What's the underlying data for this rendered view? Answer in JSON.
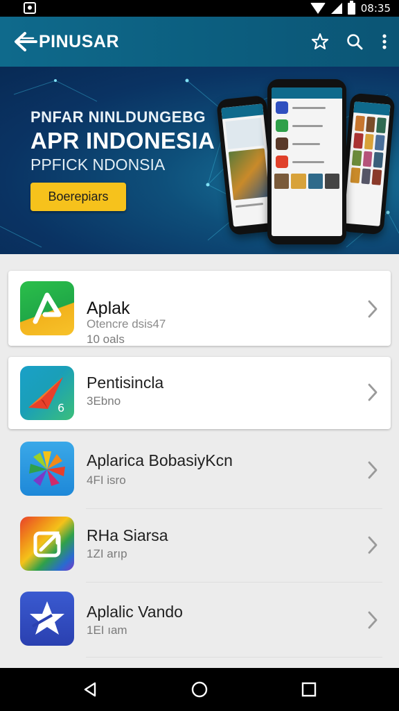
{
  "status_bar": {
    "time": "08:35"
  },
  "app_bar": {
    "title": "PINUSAR",
    "icons": [
      "back-arrow-icon",
      "star-icon",
      "search-icon",
      "more-vert-icon"
    ]
  },
  "banner": {
    "line1": "PNFAR NINLDUNGEBG",
    "line2": "APR INDONESIA",
    "line3": "PPFICK NDONSIA",
    "cta_label": "Boerepiars"
  },
  "apps": [
    {
      "name": "Aplak",
      "subtitle": "Otencre dsis47",
      "meta": "10 oals",
      "icon": "green-yellow-arrow-icon"
    },
    {
      "name": "Pentisincla",
      "meta": "3Ebno",
      "icon": "teal-red-paper-plane-icon"
    },
    {
      "name": "Aplarica BobasiyKcn",
      "meta": "4FI isro",
      "icon": "rainbow-flower-icon"
    },
    {
      "name": "RHa Siarsa",
      "meta": "1ZI arıp",
      "icon": "rainbow-share-icon"
    },
    {
      "name": "Aplalic Vando",
      "meta": "1EI ıam",
      "icon": "blue-star-icon"
    }
  ],
  "colors": {
    "app_bar": "#0f6a8c",
    "banner_bg": "#0a3363",
    "cta": "#f6c21c",
    "list_bg": "#ececec"
  }
}
